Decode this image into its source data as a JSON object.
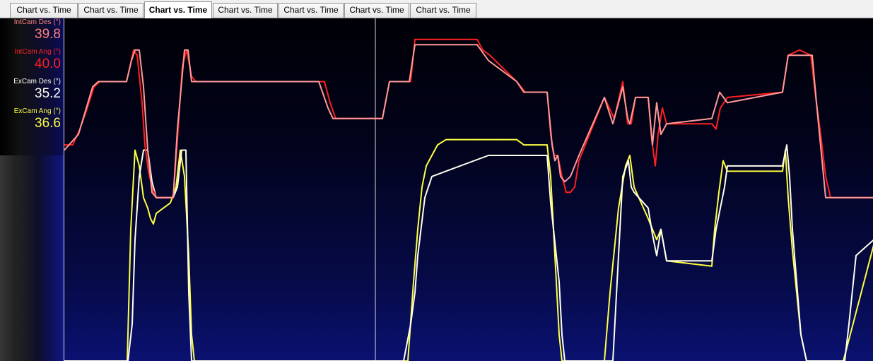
{
  "tabs": [
    {
      "label": "Chart vs. Time",
      "active": false
    },
    {
      "label": "Chart vs. Time",
      "active": false
    },
    {
      "label": "Chart vs. Time",
      "active": true
    },
    {
      "label": "Chart vs. Time",
      "active": false
    },
    {
      "label": "Chart vs. Time",
      "active": false
    },
    {
      "label": "Chart vs. Time",
      "active": false
    },
    {
      "label": "Chart vs. Time",
      "active": false
    }
  ],
  "legend": [
    {
      "name": "IntCam Des (°)",
      "value": "39.8",
      "color": "#ff8080"
    },
    {
      "name": "IntCam Ang (°)",
      "value": "40.0",
      "color": "#ff2020"
    },
    {
      "name": "ExCam Des (°)",
      "value": "35.2",
      "color": "#fffff0"
    },
    {
      "name": "ExCam Ang (°)",
      "value": "36.6",
      "color": "#ffff40"
    }
  ],
  "chart_data": {
    "type": "line",
    "title": "",
    "xlabel": "",
    "ylabel": "",
    "xlim": [
      0,
      1145
    ],
    "ylim": [
      -5,
      60
    ],
    "cursor_x": 440,
    "grid": false,
    "series": [
      {
        "name": "IntCam Des (°)",
        "color": "#ff9a9a",
        "x": [
          0,
          20,
          40,
          48,
          58,
          88,
          95,
          100,
          106,
          112,
          118,
          124,
          130,
          154,
          160,
          170,
          175,
          180,
          186,
          360,
          373,
          380,
          440,
          450,
          460,
          488,
          496,
          584,
          600,
          640,
          650,
          683,
          690,
          694,
          698,
          702,
          708,
          716,
          728,
          764,
          776,
          790,
          797,
          800,
          808,
          826,
          832,
          838,
          844,
          852,
          916,
          927,
          938,
          1016,
          1024,
          1058,
          1064,
          1077,
          1092,
          1104,
          1145
        ],
        "y": [
          35,
          38,
          47,
          48,
          48,
          48,
          52,
          54,
          54,
          47,
          35,
          27,
          26,
          26,
          39,
          54,
          54,
          48,
          48,
          48,
          43,
          41,
          41,
          41,
          48,
          48,
          55,
          55,
          52,
          48,
          46,
          46,
          36,
          33,
          34,
          30,
          29,
          30,
          34,
          45,
          40,
          47,
          41,
          40,
          45,
          45,
          36,
          44,
          38,
          40,
          41,
          46,
          44,
          46,
          53,
          53,
          44,
          26,
          26,
          26,
          26
        ]
      },
      {
        "name": "IntCam Ang (°)",
        "color": "#ff2020",
        "x": [
          0,
          12,
          22,
          30,
          42,
          50,
          60,
          88,
          93,
          98,
          103,
          110,
          114,
          119,
          124,
          130,
          154,
          160,
          167,
          173,
          180,
          186,
          360,
          368,
          376,
          384,
          440,
          450,
          460,
          490,
          496,
          510,
          584,
          592,
          602,
          640,
          652,
          683,
          688,
          693,
          698,
          704,
          710,
          716,
          722,
          728,
          764,
          771,
          778,
          790,
          797,
          802,
          808,
          826,
          831,
          836,
          840,
          846,
          852,
          916,
          922,
          928,
          938,
          1016,
          1024,
          1040,
          1056,
          1063,
          1070,
          1077,
          1084,
          1092,
          1104,
          1145
        ],
        "y": [
          36,
          36,
          39,
          42,
          47,
          48,
          48,
          48,
          51,
          54,
          53,
          44,
          36,
          31,
          28,
          26,
          26,
          37,
          51,
          54,
          49,
          48,
          48,
          48,
          44,
          41,
          41,
          41,
          48,
          48,
          56,
          56,
          56,
          54,
          53,
          48,
          46,
          46,
          38,
          34,
          34,
          30,
          27,
          27,
          28,
          33,
          45,
          43,
          41,
          48,
          40,
          40,
          45,
          45,
          37,
          32,
          38,
          43,
          40,
          40,
          39,
          43,
          45,
          46,
          53,
          54,
          53,
          45,
          38,
          30,
          26,
          26,
          26,
          26
        ]
      },
      {
        "name": "ExCam Des (°)",
        "color": "#fffff0",
        "x": [
          0,
          84,
          90,
          96,
          100,
          106,
          112,
          118,
          124,
          130,
          154,
          160,
          166,
          172,
          176,
          180,
          184,
          186,
          440,
          480,
          490,
          496,
          500,
          510,
          520,
          600,
          640,
          650,
          683,
          688,
          692,
          696,
          700,
          704,
          708,
          716,
          728,
          764,
          776,
          790,
          798,
          802,
          806,
          826,
          832,
          838,
          844,
          852,
          916,
          922,
          928,
          934,
          938,
          1016,
          1022,
          1026,
          1030,
          1036,
          1042,
          1050,
          1058,
          1064,
          1077,
          1090,
          1104,
          1110,
          1120,
          1145
        ],
        "y": [
          -5,
          -5,
          -5,
          2,
          18,
          30,
          35,
          35,
          29,
          26,
          26,
          28,
          35,
          35,
          8,
          -5,
          -5,
          -5,
          -5,
          -5,
          2,
          8,
          15,
          26,
          30,
          34,
          34,
          34,
          34,
          25,
          20,
          15,
          10,
          0,
          -5,
          -5,
          -5,
          -5,
          -5,
          30,
          33,
          28,
          27,
          24,
          19,
          15,
          20,
          14,
          14,
          20,
          24,
          28,
          32,
          32,
          36,
          30,
          20,
          10,
          0,
          -5,
          -5,
          -5,
          -5,
          -5,
          -5,
          2,
          15,
          18
        ]
      },
      {
        "name": "ExCam Ang (°)",
        "color": "#ffff40",
        "x": [
          0,
          84,
          89,
          94,
          100,
          106,
          112,
          118,
          122,
          126,
          130,
          150,
          158,
          164,
          170,
          176,
          180,
          184,
          186,
          440,
          478,
          486,
          494,
          500,
          506,
          512,
          520,
          528,
          540,
          600,
          640,
          650,
          683,
          688,
          692,
          696,
          700,
          704,
          708,
          716,
          728,
          764,
          772,
          784,
          794,
          800,
          806,
          826,
          832,
          838,
          844,
          852,
          916,
          920,
          926,
          932,
          938,
          1016,
          1020,
          1024,
          1030,
          1036,
          1042,
          1050,
          1058,
          1064,
          1076,
          1086,
          1094,
          1102,
          1145
        ],
        "y": [
          -5,
          -5,
          -5,
          20,
          35,
          32,
          26,
          24,
          22,
          21,
          23,
          25,
          28,
          35,
          30,
          15,
          0,
          -5,
          -5,
          -5,
          -5,
          -5,
          10,
          20,
          28,
          32,
          34,
          36,
          37,
          37,
          37,
          36,
          36,
          30,
          20,
          10,
          0,
          -5,
          -5,
          -5,
          -5,
          -5,
          8,
          24,
          32,
          34,
          28,
          22,
          20,
          18,
          20,
          14,
          13,
          20,
          27,
          33,
          31,
          31,
          35,
          26,
          16,
          8,
          0,
          -5,
          -5,
          -5,
          -5,
          -5,
          -5,
          -5,
          17
        ]
      }
    ]
  }
}
